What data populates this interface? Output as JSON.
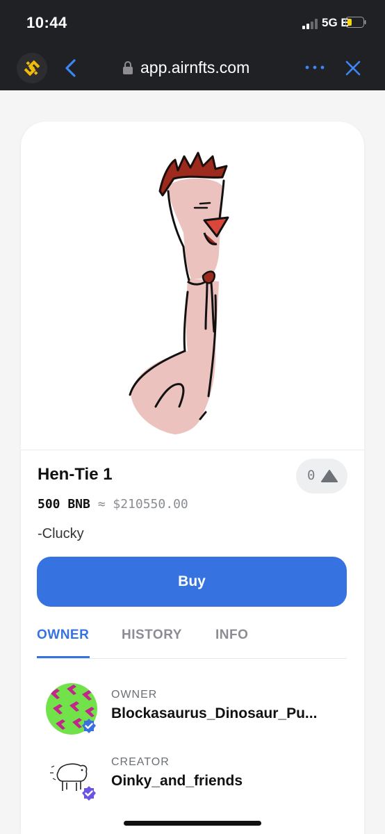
{
  "status_bar": {
    "time": "10:44",
    "network": "5G E"
  },
  "browser": {
    "url": "app.airnfts.com"
  },
  "nft": {
    "title": "Hen-Tie 1",
    "likes": "0",
    "price_bnb": "500 BNB",
    "price_approx": "≈ $210550.00",
    "description": "-Clucky",
    "buy_label": "Buy"
  },
  "tabs": [
    "OWNER",
    "HISTORY",
    "INFO"
  ],
  "owner": {
    "role": "OWNER",
    "name": "Blockasaurus_Dinosaur_Pu..."
  },
  "creator": {
    "role": "CREATOR",
    "name": "Oinky_and_friends"
  },
  "colors": {
    "accent": "#3673e0",
    "topbar": "#202124",
    "binance": "#f0b90b"
  }
}
